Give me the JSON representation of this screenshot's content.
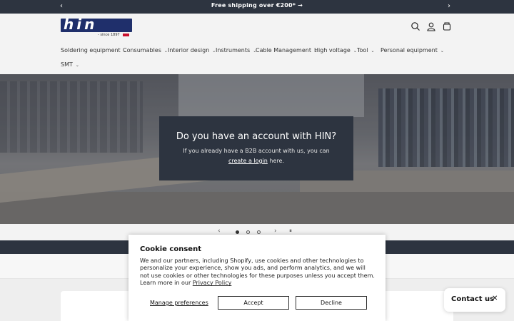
{
  "announcement": {
    "message": "Free shipping over €200* →",
    "prev_icon": "‹",
    "next_icon": "›"
  },
  "header": {
    "logo_text": "hin",
    "logo_since": "- since 1897",
    "icons": [
      "search-icon",
      "account-icon",
      "cart-icon"
    ]
  },
  "nav": {
    "items": [
      {
        "label": "Soldering equipment"
      },
      {
        "label": "Consumables"
      },
      {
        "label": "Interior design"
      },
      {
        "label": "Instruments"
      },
      {
        "label": "Cable Management"
      },
      {
        "label": "High voltage"
      },
      {
        "label": "Tool"
      },
      {
        "label": "Personal equipment"
      },
      {
        "label": "SMT"
      }
    ]
  },
  "hero": {
    "title": "Do you have an account with HIN?",
    "body_prefix": "If you already have a B2B account with us, you can ",
    "link_text": "create a login",
    "body_suffix": " here."
  },
  "slider": {
    "prev": "‹",
    "next": "›",
    "pause": "⏸",
    "slide_count": 3,
    "active_index": 0
  },
  "cookie": {
    "title": "Cookie consent",
    "body": "We and our partners, including Shopify, use cookies and other technologies to personalize your experience, show you ads, and perform analytics, and we will not use cookies or other technologies for these purposes unless you accept them. Learn more in our ",
    "policy_link": "Privacy Policy",
    "manage": "Manage preferences",
    "accept": "Accept",
    "decline": "Decline"
  },
  "contact": {
    "label": "Contact us",
    "close": "✕"
  },
  "colors": {
    "dark": "#2d3440",
    "brand_blue": "#1f2f6b",
    "brand_red": "#c8102e"
  }
}
